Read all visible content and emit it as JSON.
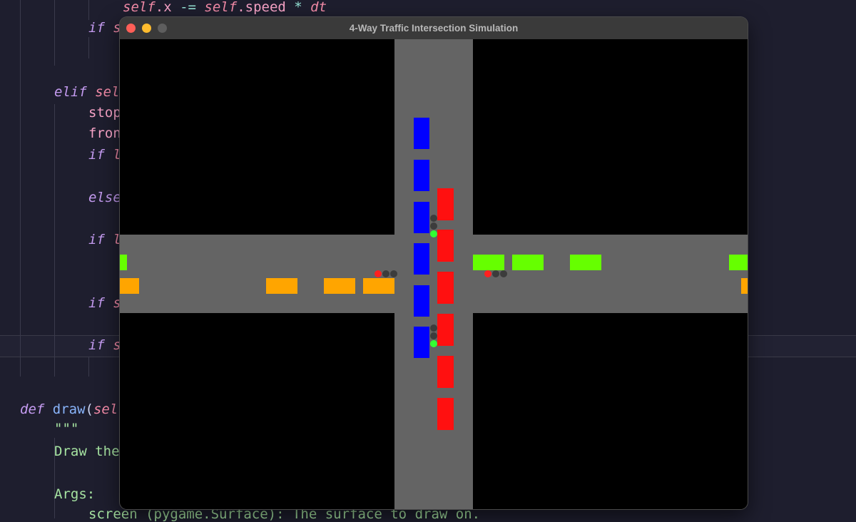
{
  "window": {
    "title": "4-Way Traffic Intersection Simulation"
  },
  "colors": {
    "road": "#646464",
    "ns_car": "#0000ff",
    "sn_car": "#ff1010",
    "we_car": "#ffa500",
    "ew_car": "#66ff00",
    "light_red": "#ff2020",
    "light_green": "#33ff33",
    "light_off": "#3c3c3c"
  },
  "simulation": {
    "cars_southbound_blue": 6,
    "cars_northbound_red": 6,
    "cars_eastbound_orange": 5,
    "cars_westbound_green": 5,
    "lights": {
      "north": "green",
      "south": "green",
      "west": "red",
      "east": "red"
    }
  },
  "code": {
    "l1": {
      "a": "self",
      "b": ".x ",
      "c": "-= ",
      "d": "self",
      "e": ".speed ",
      "f": "* ",
      "g": "dt"
    },
    "l2": {
      "a": "if ",
      "b": "s"
    },
    "l3": {
      "a": "elif ",
      "b": "sel"
    },
    "l4": "stop",
    "l5": "fron",
    "l6": {
      "a": "if ",
      "b": "l"
    },
    "l7": "else",
    "l8": {
      "a": "if ",
      "b": "l"
    },
    "l9": {
      "a": "if ",
      "b": "s"
    },
    "l10": {
      "a": "if ",
      "b": "s"
    },
    "l11": {
      "a": "def ",
      "b": "draw",
      "c": "(",
      "d": "sel"
    },
    "l12": "\"\"\"",
    "l13": "Draw the",
    "l14": "Args:",
    "l15": {
      "a": "screen ",
      "b": "(pygame.Surface): The surface to draw on."
    }
  }
}
